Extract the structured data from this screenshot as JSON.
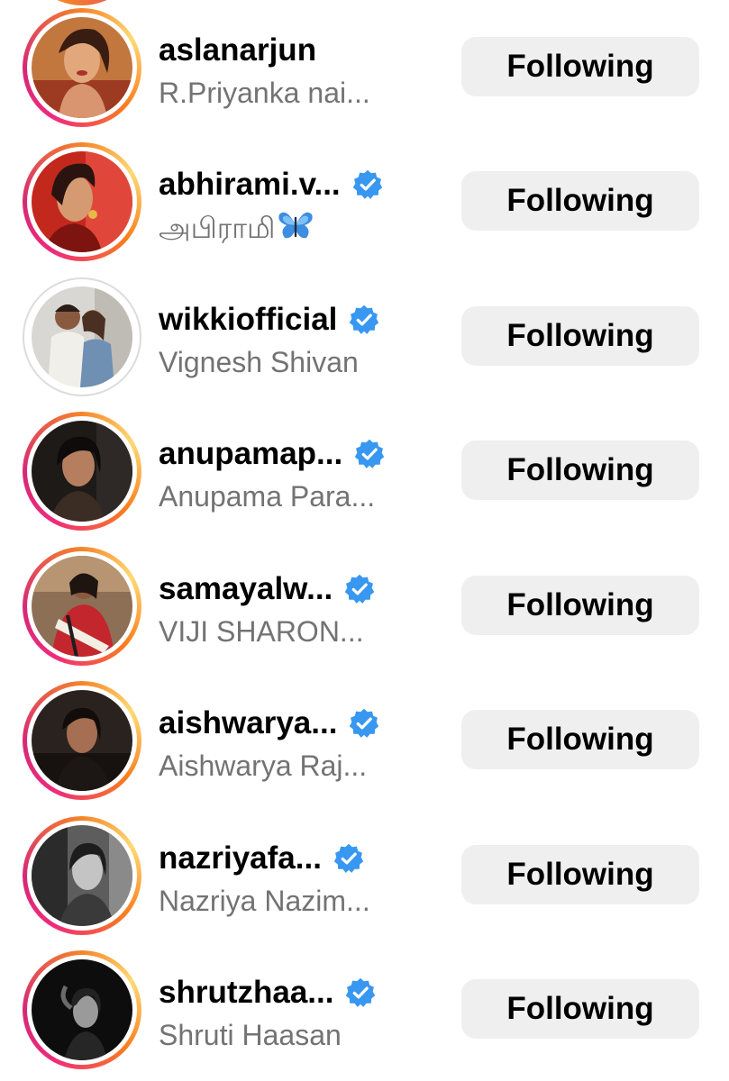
{
  "accounts": [
    {
      "username": "aslanarjun",
      "full_name": "R.Priyanka nai...",
      "verified": false,
      "story_ring": "unseen",
      "action_label": "Following",
      "avatar": "woman-portrait-red"
    },
    {
      "username": "abhirami.v...",
      "full_name": "அபிராமி",
      "name_emoji": "butterfly",
      "verified": true,
      "story_ring": "unseen",
      "action_label": "Following",
      "avatar": "woman-portrait-red-background"
    },
    {
      "username": "wikkiofficial",
      "full_name": "Vignesh Shivan",
      "verified": true,
      "story_ring": "seen",
      "action_label": "Following",
      "avatar": "couple-photo"
    },
    {
      "username": "anupamap...",
      "full_name": "Anupama Para...",
      "verified": true,
      "story_ring": "unseen",
      "action_label": "Following",
      "avatar": "woman-portrait-dark"
    },
    {
      "username": "samayalw...",
      "full_name": "VIJI SHARON...",
      "verified": true,
      "story_ring": "unseen",
      "action_label": "Following",
      "avatar": "woman-in-saree"
    },
    {
      "username": "aishwarya...",
      "full_name": "Aishwarya Raj...",
      "verified": true,
      "story_ring": "unseen",
      "action_label": "Following",
      "avatar": "woman-portrait-dark"
    },
    {
      "username": "nazriyafa...",
      "full_name": "Nazriya Nazim...",
      "verified": true,
      "story_ring": "unseen",
      "action_label": "Following",
      "avatar": "woman-portrait-bw"
    },
    {
      "username": "shrutzhaa...",
      "full_name": "Shruti Haasan",
      "verified": true,
      "story_ring": "unseen",
      "action_label": "Following",
      "avatar": "woman-portrait-night"
    }
  ],
  "colors": {
    "verified_badge": "#3897f0",
    "button_background": "#efefef",
    "secondary_text": "#737373",
    "ring_gradient": [
      "#ee2a7b",
      "#d62976",
      "#f58529",
      "#feda75"
    ]
  }
}
